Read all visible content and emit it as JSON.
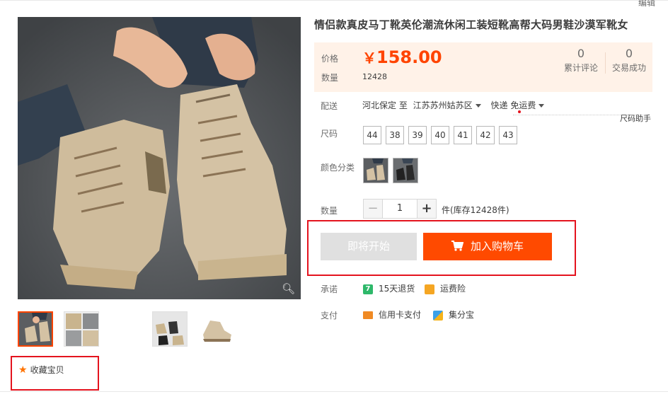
{
  "edit_link": "编辑",
  "product": {
    "title": "情侣款真皮马丁靴英伦潮流休闲工装短靴高帮大码男鞋沙漠军靴女"
  },
  "price_panel": {
    "price_label": "价格",
    "currency": "￥",
    "price": "158.00",
    "qty_label": "数量",
    "qty_value": "12428",
    "reviews_count": "0",
    "reviews_label": "累计评论",
    "sales_count": "0",
    "sales_label": "交易成功"
  },
  "shipping": {
    "label": "配送",
    "from": "河北保定 至",
    "to": "江苏苏州姑苏区",
    "method": "快递 免运费",
    "size_helper": "尺码助手"
  },
  "size": {
    "label": "尺码",
    "options": [
      "44",
      "38",
      "39",
      "40",
      "41",
      "42",
      "43"
    ]
  },
  "color": {
    "label": "颜色分类"
  },
  "quantity": {
    "label": "数量",
    "minus": "−",
    "value": "1",
    "plus": "+",
    "stock_text": "件(库存12428件)"
  },
  "buttons": {
    "coming_soon": "即将开始",
    "add_to_cart": "加入购物车"
  },
  "promise": {
    "label": "承诺",
    "return": "15天退货",
    "freight": "运费险"
  },
  "payment": {
    "label": "支付",
    "credit": "信用卡支付",
    "jifenbao": "集分宝"
  },
  "favorite": {
    "label": "收藏宝贝"
  },
  "icons": {
    "zoom": "zoom-icon",
    "star": "star-icon",
    "cart": "cart-icon"
  },
  "colors": {
    "accent": "#ff4400",
    "price_bg": "#fff2e8",
    "highlight_box": "#e4131e"
  }
}
